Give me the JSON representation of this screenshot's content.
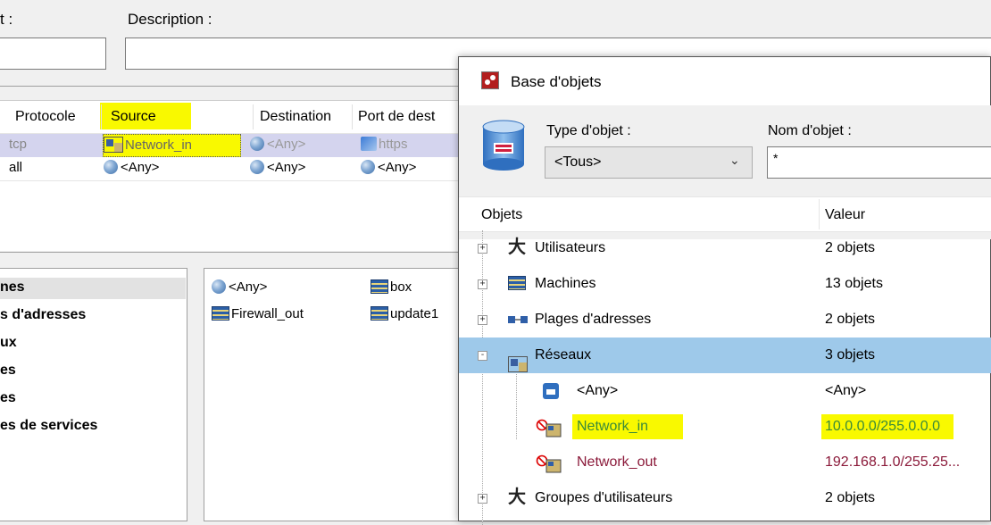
{
  "form": {
    "name_label_partial": "t :",
    "description_label": "Description :",
    "name_value": "",
    "description_value": ""
  },
  "rules_table": {
    "headers": [
      "Protocole",
      "Source",
      "Destination",
      "Port de dest"
    ],
    "rows": [
      {
        "protocol": "tcp",
        "source": "Network_in",
        "destination": "<Any>",
        "port": "https"
      },
      {
        "protocol": "all",
        "source": "<Any>",
        "destination": "<Any>",
        "port": "<Any>"
      }
    ]
  },
  "category_list": {
    "items": [
      "nes",
      "s d'adresses",
      "ux",
      "es",
      "es",
      "es de services"
    ]
  },
  "object_list": {
    "items": [
      "<Any>",
      "box",
      "Firewall_out",
      "update1"
    ]
  },
  "dialog": {
    "title": "Base d'objets",
    "type_label": "Type d'objet :",
    "type_value": "<Tous>",
    "name_label": "Nom d'objet :",
    "name_value": "*",
    "col_objects": "Objets",
    "col_value": "Valeur",
    "tree": [
      {
        "label": "Utilisateurs",
        "value": "2 objets",
        "icon": "users-icon",
        "expander": "+"
      },
      {
        "label": "Machines",
        "value": "13 objets",
        "icon": "machine-icon",
        "expander": "+"
      },
      {
        "label": "Plages d'adresses",
        "value": "2 objets",
        "icon": "address-range-icon",
        "expander": "+"
      },
      {
        "label": "Réseaux",
        "value": "3 objets",
        "icon": "network-icon",
        "expander": "-",
        "selected": true
      },
      {
        "label": "<Any>",
        "value": "<Any>",
        "icon": "any-object-icon",
        "child": true
      },
      {
        "label": "Network_in",
        "value": "10.0.0.0/255.0.0.0",
        "icon": "network-object-icon",
        "child": true,
        "highlight": true
      },
      {
        "label": "Network_out",
        "value": "192.168.1.0/255.25...",
        "icon": "network-object-icon",
        "child": true
      },
      {
        "label": "Groupes d'utilisateurs",
        "value": "2 objets",
        "icon": "user-groups-icon",
        "expander": "+"
      }
    ]
  },
  "colors": {
    "selection": "#9ec9ea",
    "highlight": "#f9f900",
    "row_selected": "#d4d4ee",
    "link_red": "#8b1a3a",
    "green_text": "#3a8a3a"
  }
}
